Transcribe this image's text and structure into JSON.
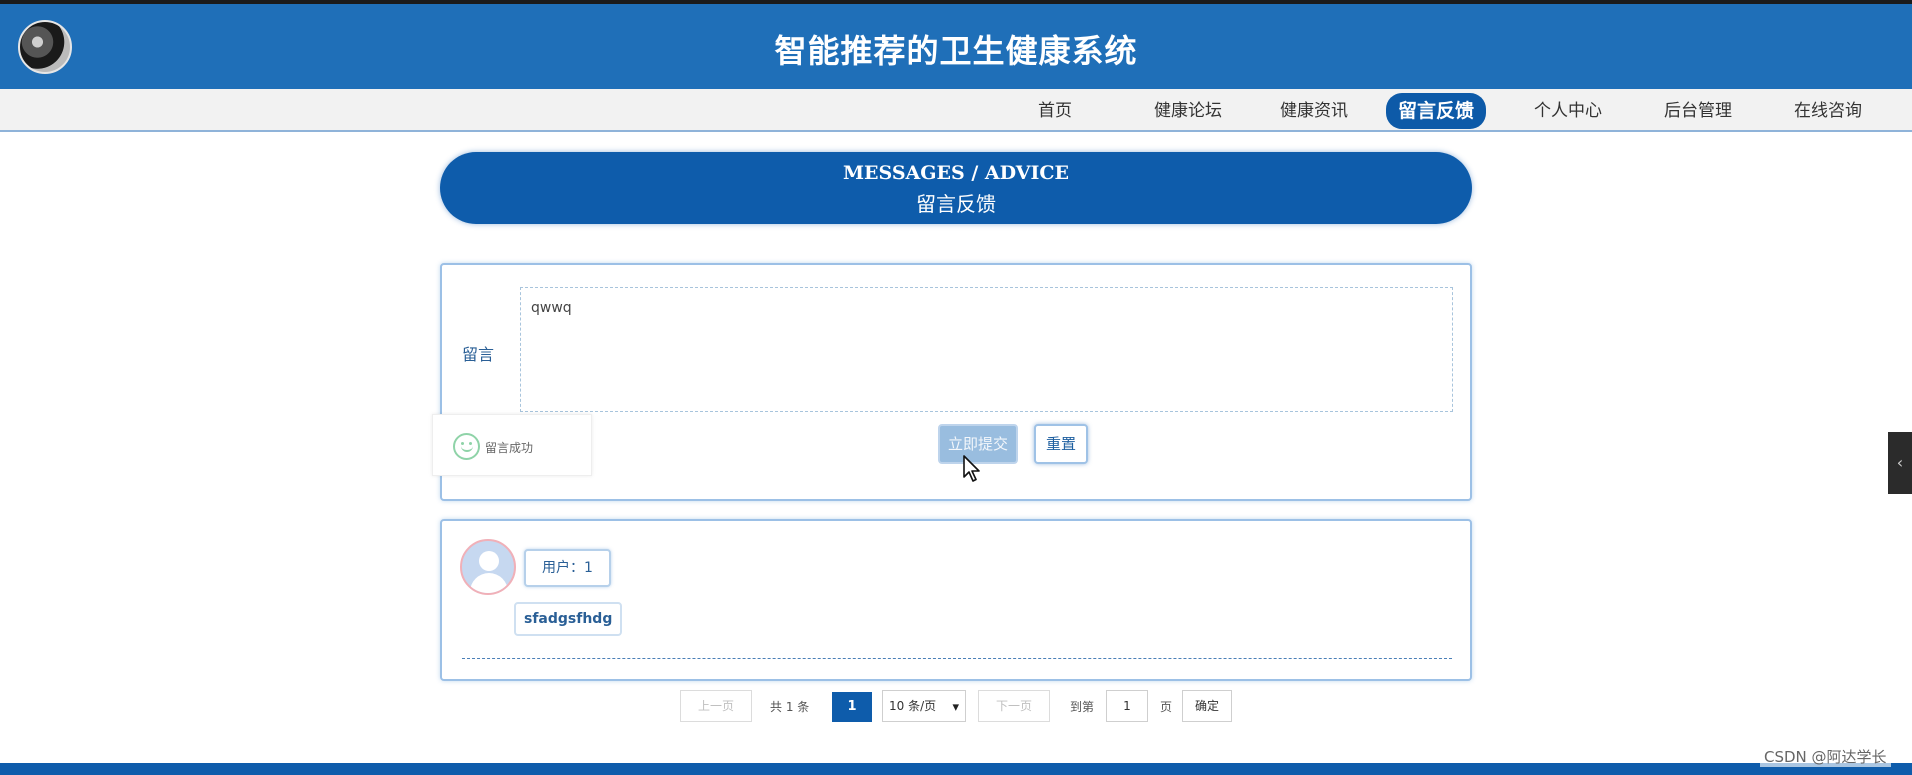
{
  "header": {
    "site_title": "智能推荐的卫生健康系统"
  },
  "nav": {
    "items": [
      {
        "label": "首页"
      },
      {
        "label": "健康论坛"
      },
      {
        "label": "健康资讯"
      },
      {
        "label": "留言反馈",
        "active": true
      },
      {
        "label": "个人中心"
      },
      {
        "label": "后台管理"
      },
      {
        "label": "在线咨询"
      }
    ]
  },
  "banner": {
    "en": "MESSAGES / ADVICE",
    "cn": "留言反馈"
  },
  "form": {
    "label": "留言",
    "textarea_value": "qwwq",
    "submit_label": "立即提交",
    "reset_label": "重置"
  },
  "toast": {
    "message": "留言成功",
    "icon": "smile-icon"
  },
  "messages": [
    {
      "user": "用户：1",
      "content": "sfadgsfhdg"
    }
  ],
  "pager": {
    "prev": "上一页",
    "total": "共 1 条",
    "current": "1",
    "page_size": "10 条/页",
    "next": "下一页",
    "goto_label": "到第",
    "goto_value": "1",
    "page_unit": "页",
    "confirm": "确定"
  },
  "side_tab": {
    "icon": "chevron-left-icon",
    "glyph": "‹"
  },
  "watermark": "CSDN @阿达学长",
  "colors": {
    "header_blue": "#1f6fb8",
    "primary_blue": "#0e5cab",
    "nav_bg": "#f2f2f2"
  }
}
